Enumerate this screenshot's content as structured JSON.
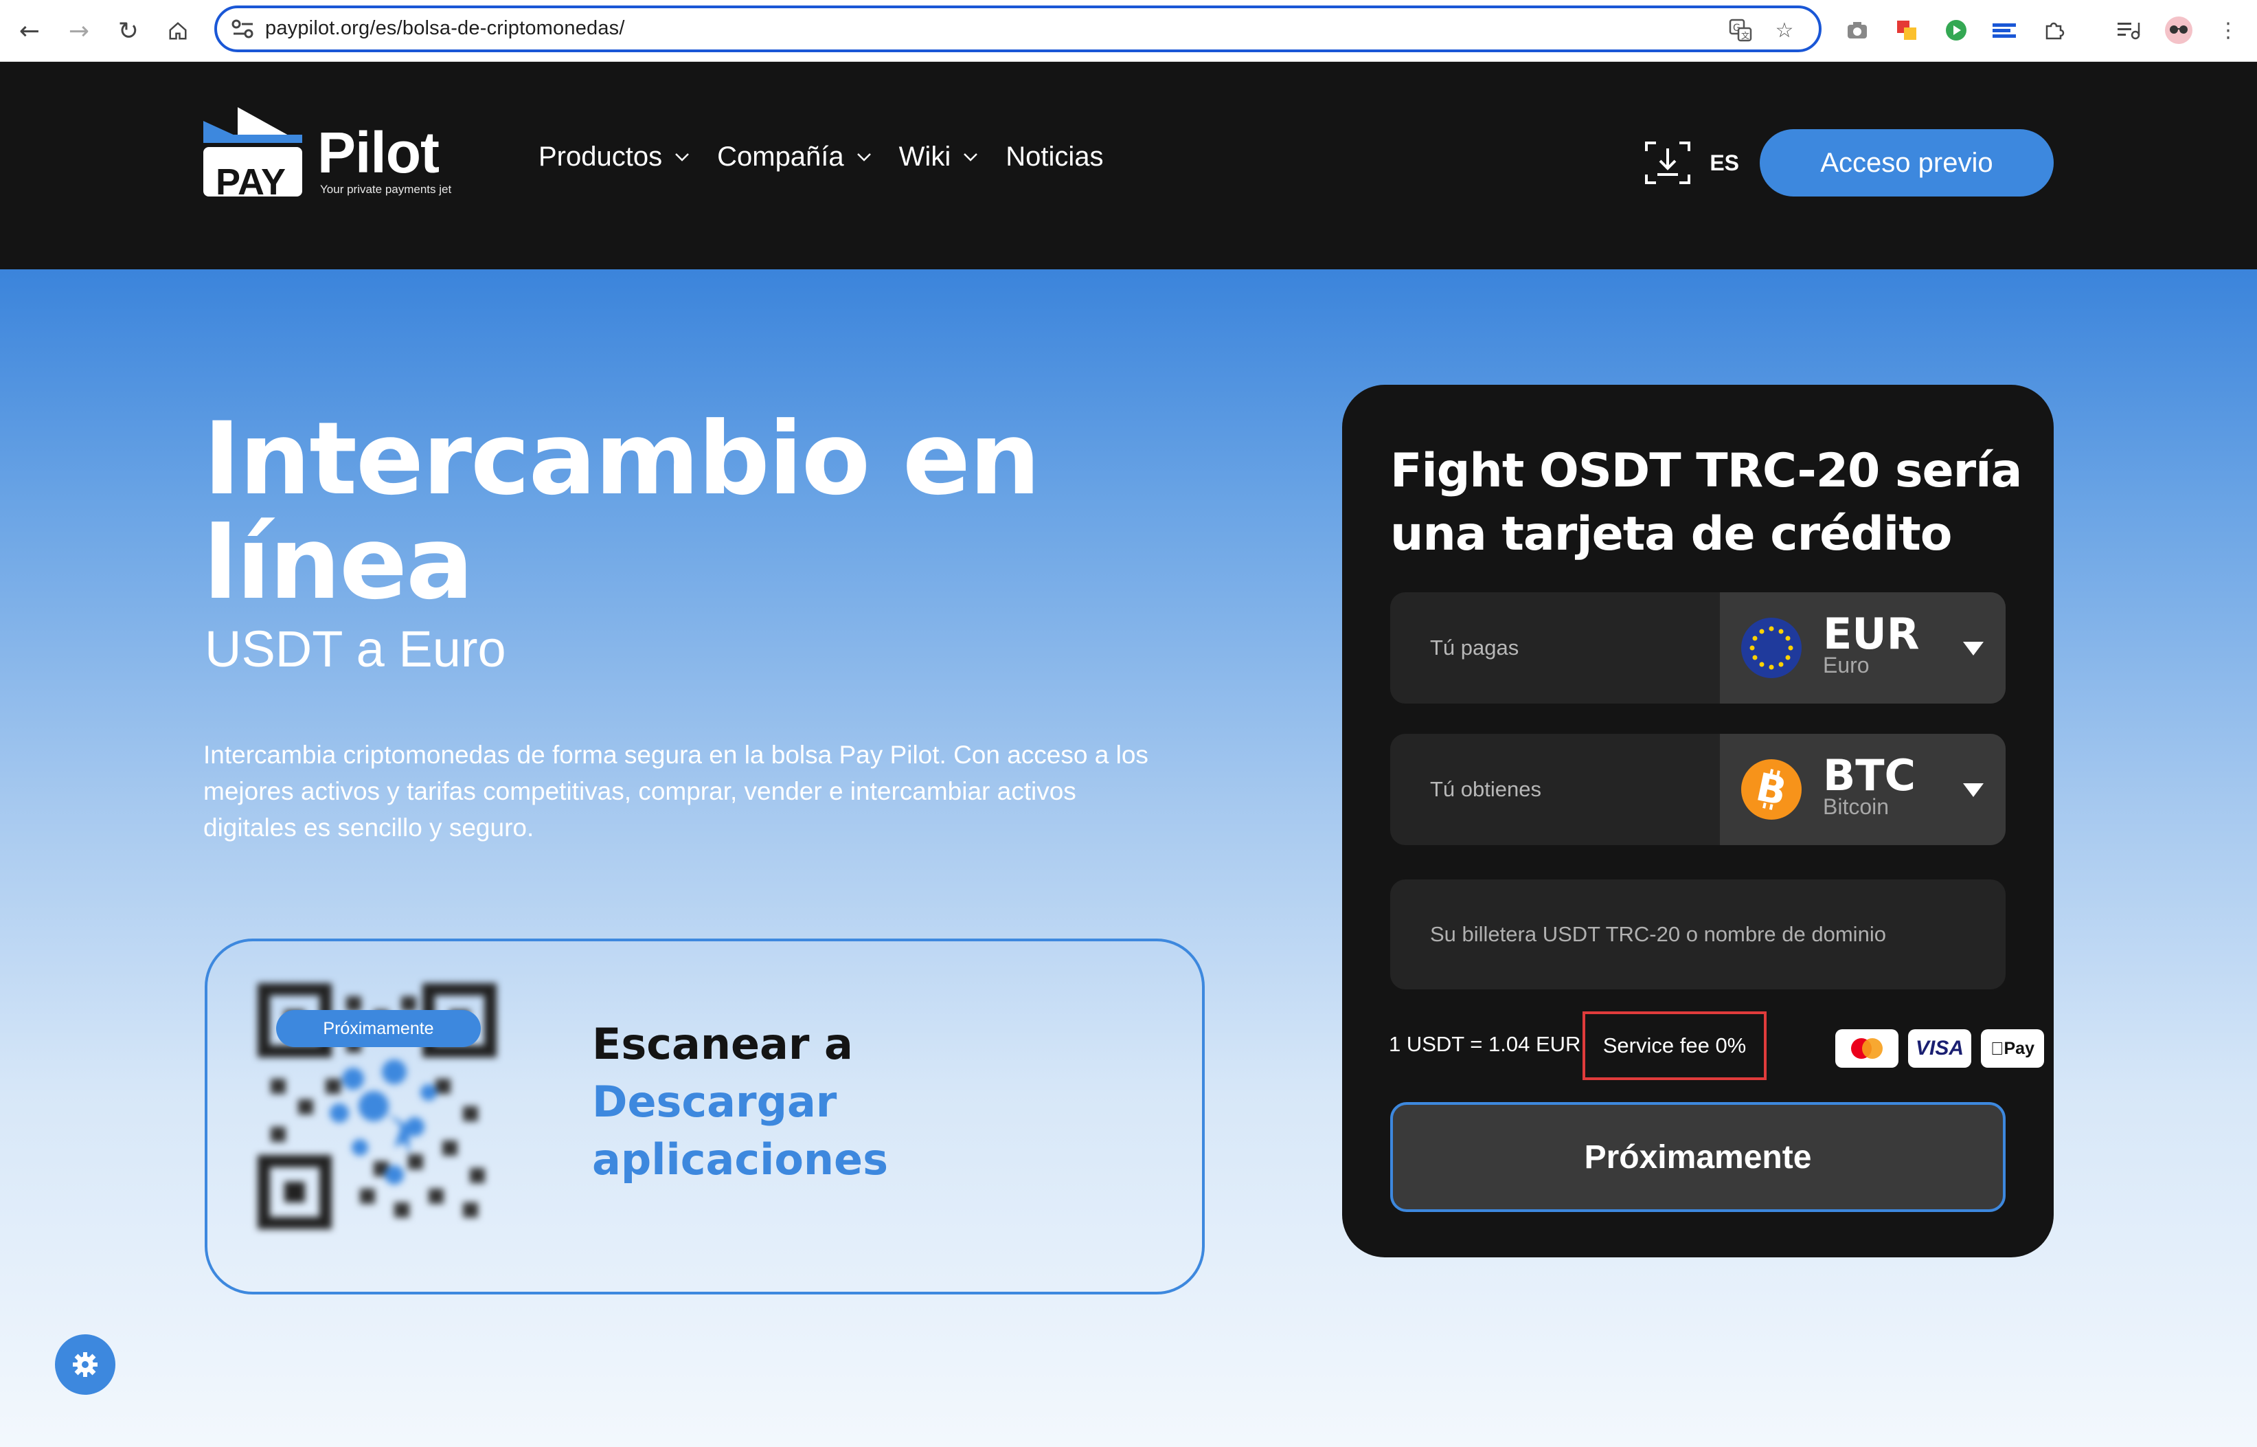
{
  "browser": {
    "url": "paypilot.org/es/bolsa-de-criptomonedas/",
    "icons": [
      "back-icon",
      "forward-icon",
      "reload-icon",
      "home-icon",
      "site-settings-icon",
      "translate-icon",
      "bookmark-star-icon",
      "camera-icon",
      "extension-icons",
      "puzzle-icon",
      "media-icon",
      "profile-avatar-icon",
      "menu-icon"
    ]
  },
  "header": {
    "logo_badge": "PAY",
    "logo_name": "Pilot",
    "logo_tagline": "Your private payments jet",
    "nav": [
      {
        "label": "Productos",
        "has_dropdown": true
      },
      {
        "label": "Compañía",
        "has_dropdown": true
      },
      {
        "label": "Wiki",
        "has_dropdown": true
      },
      {
        "label": "Noticias",
        "has_dropdown": false
      }
    ],
    "language": "ES",
    "cta_label": "Acceso previo"
  },
  "hero": {
    "title_line1": "Intercambio en",
    "title_line2": "línea",
    "subtitle": "USDT a Euro",
    "description": "Intercambia criptomonedas de forma segura en la bolsa Pay Pilot. Con acceso a los mejores activos y tarifas competitivas, comprar, vender e intercambiar activos digitales es sencillo y seguro."
  },
  "qr_card": {
    "badge": "Próximamente",
    "line1": "Escanear a",
    "line2": "Descargar",
    "line3": "aplicaciones"
  },
  "exchange": {
    "title": "Fight OSDT TRC-20 sería una tarjeta de crédito",
    "pay": {
      "label": "Tú pagas",
      "code": "EUR",
      "name": "Euro"
    },
    "get": {
      "label": "Tú obtienes",
      "code": "BTC",
      "name": "Bitcoin"
    },
    "wallet_placeholder": "Su billetera USDT TRC-20 o nombre de dominio",
    "rate": "1 USDT = 1.04 EUR",
    "fee": "Service fee 0%",
    "payment_methods": [
      "mastercard-icon",
      "visa-icon",
      "apple-pay-icon"
    ],
    "visa_label": "VISA",
    "applepay_label": "Pay",
    "submit_label": "Próximamente"
  },
  "colors": {
    "accent": "#3d88de",
    "header_bg": "#141414",
    "card_bg": "#141414",
    "highlight_border": "#e03b3b"
  }
}
